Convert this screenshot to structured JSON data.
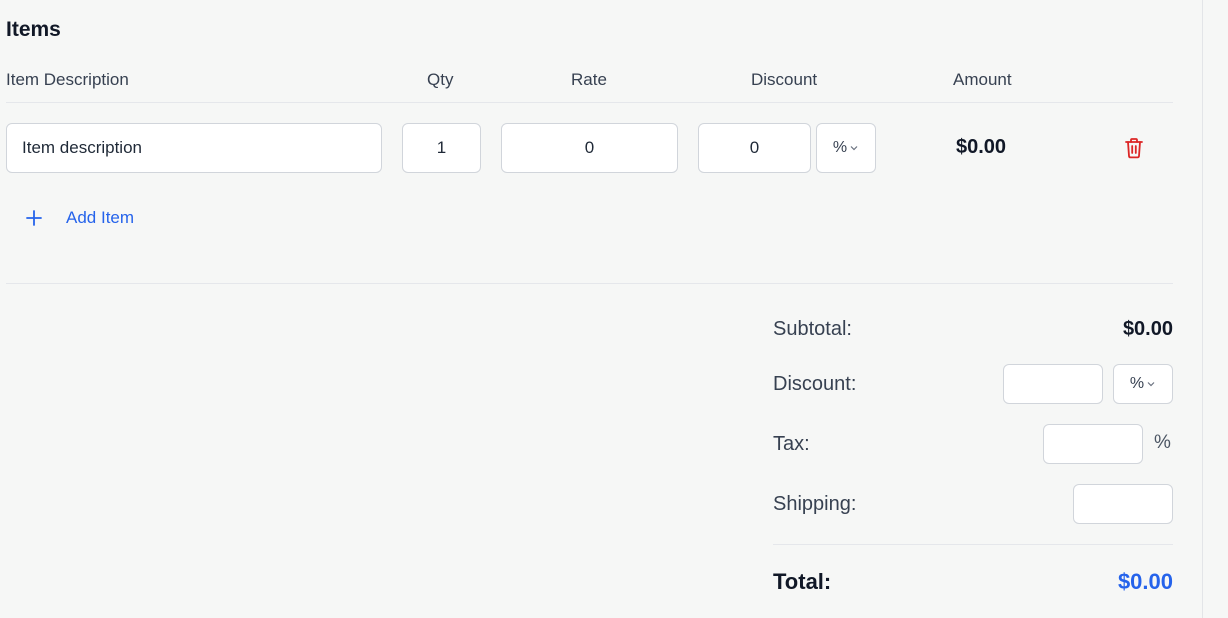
{
  "section": {
    "title": "Items"
  },
  "columns": {
    "description": "Item Description",
    "qty": "Qty",
    "rate": "Rate",
    "discount": "Discount",
    "amount": "Amount"
  },
  "row": {
    "description_placeholder": "Item description",
    "qty": "1",
    "rate": "0",
    "discount": "0",
    "discount_type": "%",
    "amount": "$0.00",
    "delete_icon": "trash-icon"
  },
  "actions": {
    "add_item": "Add Item",
    "add_icon": "plus-icon"
  },
  "summary": {
    "subtotal_label": "Subtotal:",
    "subtotal_value": "$0.00",
    "discount_label": "Discount:",
    "discount_value": "",
    "discount_type": "%",
    "tax_label": "Tax:",
    "tax_value": "",
    "tax_unit": "%",
    "shipping_label": "Shipping:",
    "shipping_value": "",
    "total_label": "Total:",
    "total_value": "$0.00"
  },
  "colors": {
    "accent": "#2563eb",
    "danger": "#dc2626",
    "background": "#f6f7f6"
  }
}
